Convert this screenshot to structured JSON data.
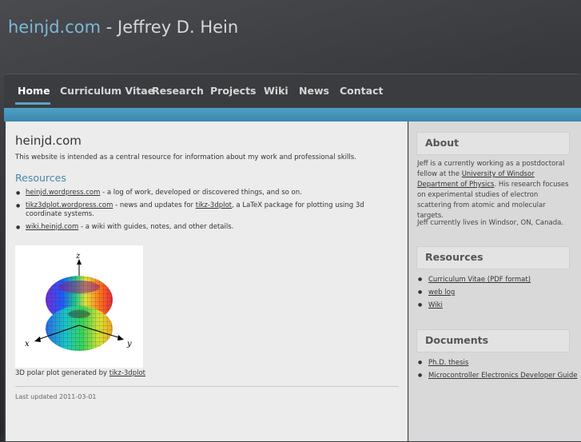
{
  "header": {
    "domain": "heinjd.com",
    "separator": " - ",
    "name": "Jeffrey D. Hein"
  },
  "nav": {
    "items": [
      {
        "label": "Home"
      },
      {
        "label": "Curriculum Vitae"
      },
      {
        "label": "Research"
      },
      {
        "label": "Projects"
      },
      {
        "label": "Wiki"
      },
      {
        "label": "News"
      },
      {
        "label": "Contact"
      }
    ]
  },
  "main": {
    "title": "heinjd.com",
    "intro": "This website is intended as a central resource for information about my work and professional skills.",
    "resources_heading": "Resources",
    "resources": [
      {
        "link": "heinjd.wordpress.com",
        "text1": " - a log of work, developed or discovered things, and so on."
      },
      {
        "link": "tikz3dplot.wordpress.com",
        "text1": " - news and updates for ",
        "link2": "tikz-3dplot",
        "text2": ", a LaTeX package for plotting using 3d coordinate systems."
      },
      {
        "link": "wiki.heinjd.com",
        "text1": " - a wiki with guides, notes, and other details."
      }
    ],
    "figure": {
      "axis_z": "z",
      "axis_x": "x",
      "axis_y": "y"
    },
    "caption_text": "3D polar plot generated by ",
    "caption_link": "tikz-3dplot",
    "updated": "Last updated 2011-03-01"
  },
  "sidebar": {
    "about_heading": "About",
    "about_p1_a": "Jeff is a currently working as a postdoctoral fellow at the ",
    "about_p1_link": "University of Windsor Department of Physics",
    "about_p1_b": ". His research focuses on experimental studies of electron scattering from atomic and molecular targets.",
    "about_p2": "Jeff currently lives in Windsor, ON, Canada.",
    "resources_heading": "Resources",
    "resources": [
      "Curriculum Vitae (PDF format)",
      "web log",
      "Wiki"
    ],
    "documents_heading": "Documents",
    "documents": [
      "Ph.D. thesis",
      "Microcontroller Electronics Developer Guide"
    ]
  }
}
